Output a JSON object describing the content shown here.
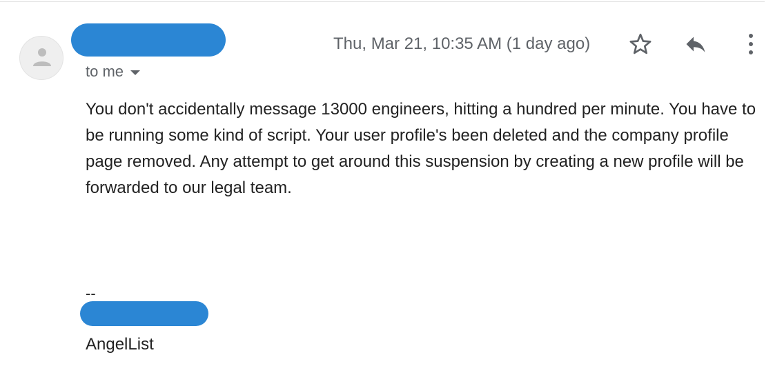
{
  "message": {
    "timestamp": "Thu, Mar 21, 10:35 AM (1 day ago)",
    "recipient": "to me",
    "body": "You don't accidentally message 13000 engineers, hitting a hundred per minute. You have to be running some kind of script. Your user profile's been deleted and the company profile page removed. Any attempt to get around this suspension by creating a new profile will be forwarded to our legal team.",
    "signature": {
      "separator": "--",
      "company": "AngelList"
    }
  },
  "icons": {
    "avatar": "person-icon",
    "star": "star-icon",
    "reply": "reply-icon",
    "more": "more-vert-icon",
    "recipient_dropdown": "chevron-down-icon"
  },
  "colors": {
    "redaction": "#2b86d4",
    "secondary_text": "#5f6368",
    "body_text": "#222222"
  }
}
